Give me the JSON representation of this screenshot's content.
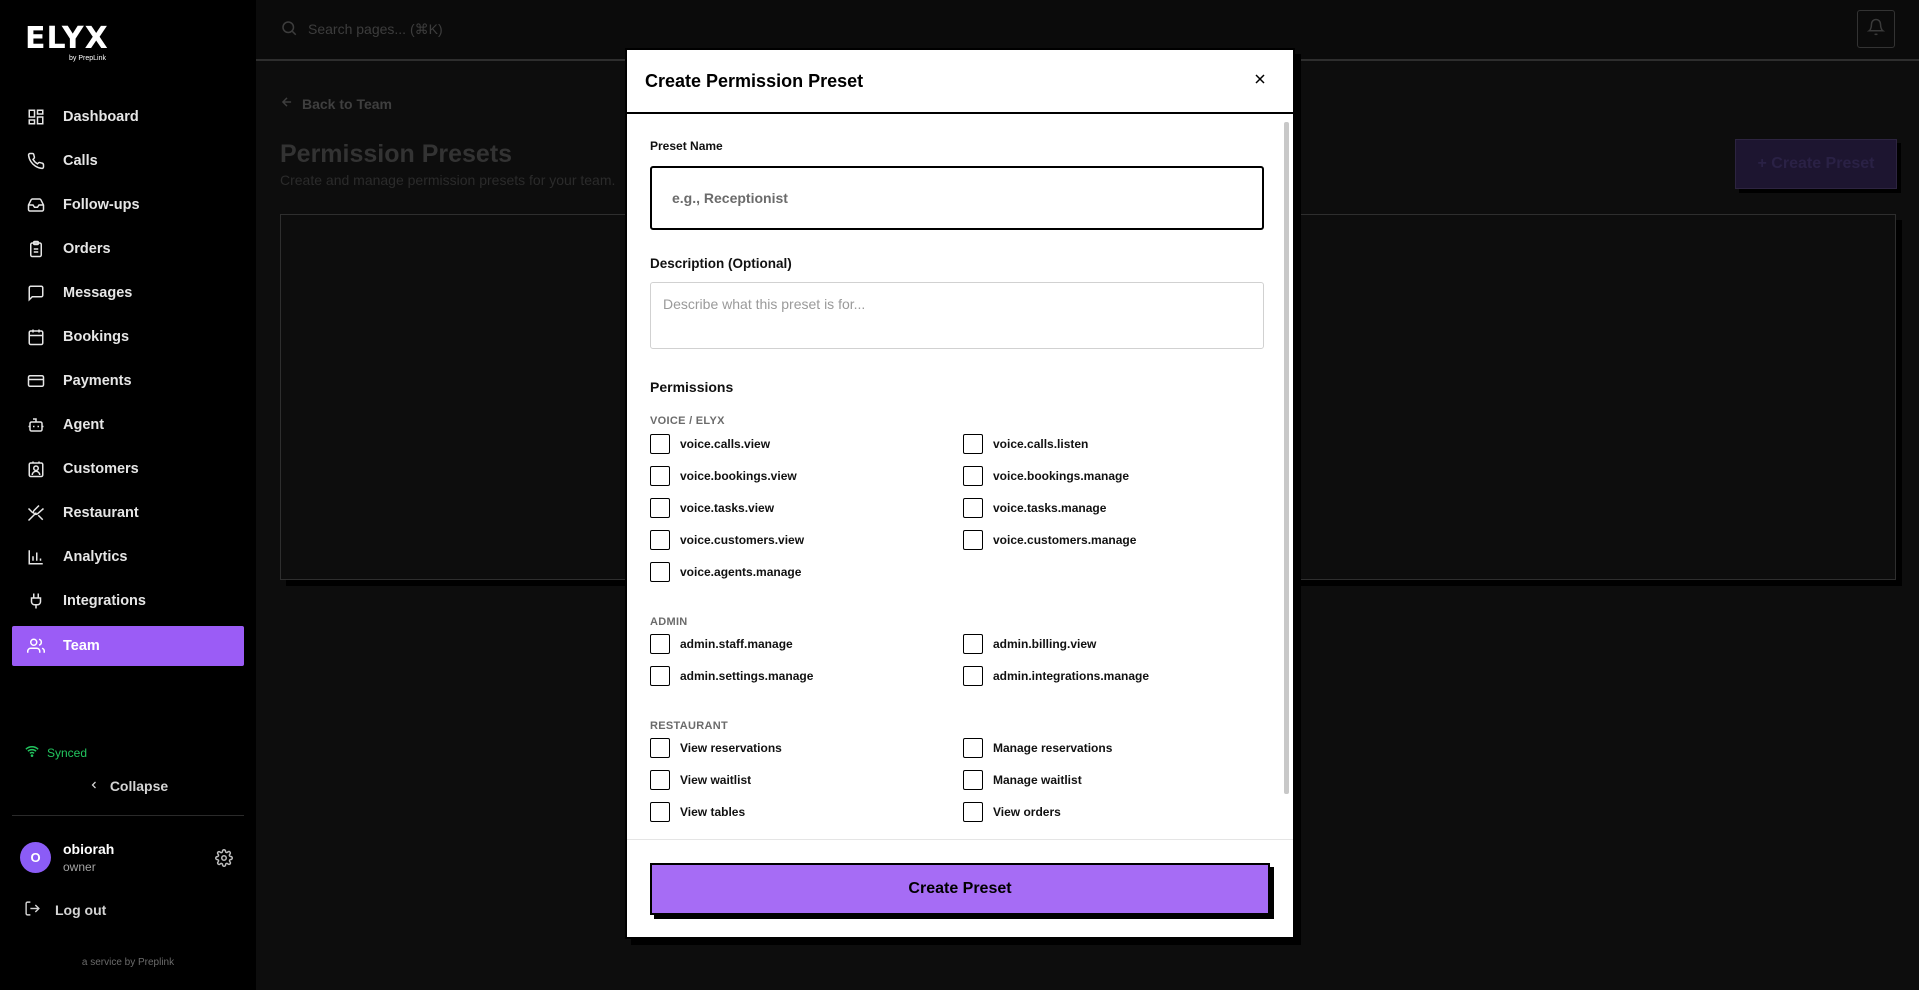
{
  "brand": {
    "logo": "ELYX",
    "sub": "by PrepLink"
  },
  "nav": [
    {
      "label": "Dashboard",
      "icon": "dashboard-icon"
    },
    {
      "label": "Calls",
      "icon": "phone-icon"
    },
    {
      "label": "Follow-ups",
      "icon": "inbox-icon"
    },
    {
      "label": "Orders",
      "icon": "clipboard-icon"
    },
    {
      "label": "Messages",
      "icon": "message-icon"
    },
    {
      "label": "Bookings",
      "icon": "calendar-icon"
    },
    {
      "label": "Payments",
      "icon": "credit-card-icon"
    },
    {
      "label": "Agent",
      "icon": "bot-icon"
    },
    {
      "label": "Customers",
      "icon": "contact-icon"
    },
    {
      "label": "Restaurant",
      "icon": "utensils-icon"
    },
    {
      "label": "Analytics",
      "icon": "bar-chart-icon"
    },
    {
      "label": "Integrations",
      "icon": "plug-icon"
    }
  ],
  "nav_active": {
    "label": "Team",
    "icon": "users-icon"
  },
  "status": {
    "synced": "Synced"
  },
  "collapse_label": "Collapse",
  "user": {
    "initial": "O",
    "name": "obiorah",
    "role": "owner"
  },
  "logout_label": "Log out",
  "service_text": "a service by Preplink",
  "topbar": {
    "search_placeholder": "Search pages... (⌘K)"
  },
  "page": {
    "back_label": "Back to Team",
    "title": "Permission Presets",
    "subtitle": "Create and manage permission presets for your team.",
    "create_label": "+ Create Preset"
  },
  "modal": {
    "title": "Create Permission Preset",
    "name_label": "Preset Name",
    "name_placeholder": "e.g., Receptionist",
    "desc_label": "Description (Optional)",
    "desc_placeholder": "Describe what this preset is for...",
    "permissions_title": "Permissions",
    "groups": [
      {
        "label": "VOICE / ELYX",
        "items": [
          "voice.calls.view",
          "voice.calls.listen",
          "voice.bookings.view",
          "voice.bookings.manage",
          "voice.tasks.view",
          "voice.tasks.manage",
          "voice.customers.view",
          "voice.customers.manage",
          "voice.agents.manage"
        ]
      },
      {
        "label": "ADMIN",
        "items": [
          "admin.staff.manage",
          "admin.billing.view",
          "admin.settings.manage",
          "admin.integrations.manage"
        ]
      },
      {
        "label": "RESTAURANT",
        "items": [
          "View reservations",
          "Manage reservations",
          "View waitlist",
          "Manage waitlist",
          "View tables",
          "View orders"
        ]
      }
    ],
    "submit_label": "Create Preset"
  },
  "colors": {
    "accent": "#9b5cf6",
    "button": "#a66cf5",
    "synced": "#22c55e"
  }
}
